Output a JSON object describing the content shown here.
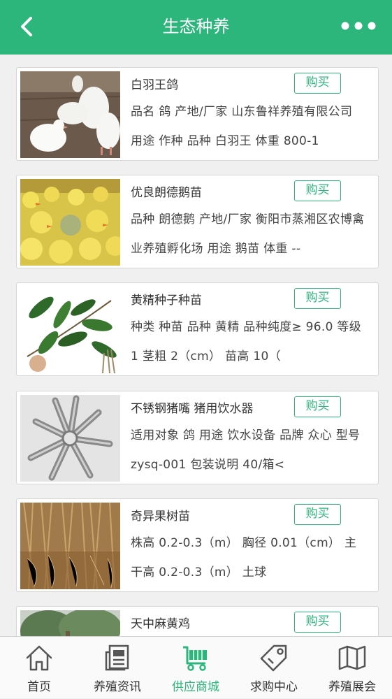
{
  "header": {
    "title": "生态种养",
    "back_icon": "chevron-left-icon",
    "more_icon": "more-dots-icon",
    "color": "#2db67c"
  },
  "products": [
    {
      "name": "白羽王鸽",
      "buy_label": "购买",
      "desc": "品名 鸽 产地/厂家 山东鲁祥养殖有限公司 用途 作种 品种 白羽王 体重 800-1",
      "image": "white-pigeons-photo"
    },
    {
      "name": "优良朗德鹅苗",
      "buy_label": "购买",
      "desc": "品种 朗德鹅 产地/厂家 衡阳市蒸湘区农博禽业养殖孵化场 用途 鹅苗 体重 --",
      "image": "goslings-photo"
    },
    {
      "name": "黄精种子种苗",
      "buy_label": "购买",
      "desc": "种类 种苗 品种 黄精 品种纯度≥ 96.0 等级 1 茎粗 2（cm） 苗高 10（",
      "image": "polygonatum-seedling-photo"
    },
    {
      "name": "不锈钢猪嘴 猪用饮水器",
      "buy_label": "购买",
      "desc": "适用对象 鸽 用途 饮水设备 品牌 众心 型号 zysq-001 包装说明 40/箱<",
      "image": "steel-drinkers-photo"
    },
    {
      "name": "奇异果树苗",
      "buy_label": "购买",
      "desc": "株高 0.2-0.3（m） 胸径 0.01（cm） 主干高 0.2-0.3（m） 土球",
      "image": "kiwi-seedlings-photo"
    },
    {
      "name": "天中麻黄鸡",
      "buy_label": "购买",
      "desc": "",
      "image": "tree-photo"
    }
  ],
  "tabs": [
    {
      "label": "首页",
      "icon": "home-icon",
      "active": false
    },
    {
      "label": "养殖资讯",
      "icon": "news-icon",
      "active": false
    },
    {
      "label": "供应商城",
      "icon": "cart-icon",
      "active": true
    },
    {
      "label": "求购中心",
      "icon": "tag-icon",
      "active": false
    },
    {
      "label": "养殖展会",
      "icon": "map-icon",
      "active": false
    }
  ]
}
